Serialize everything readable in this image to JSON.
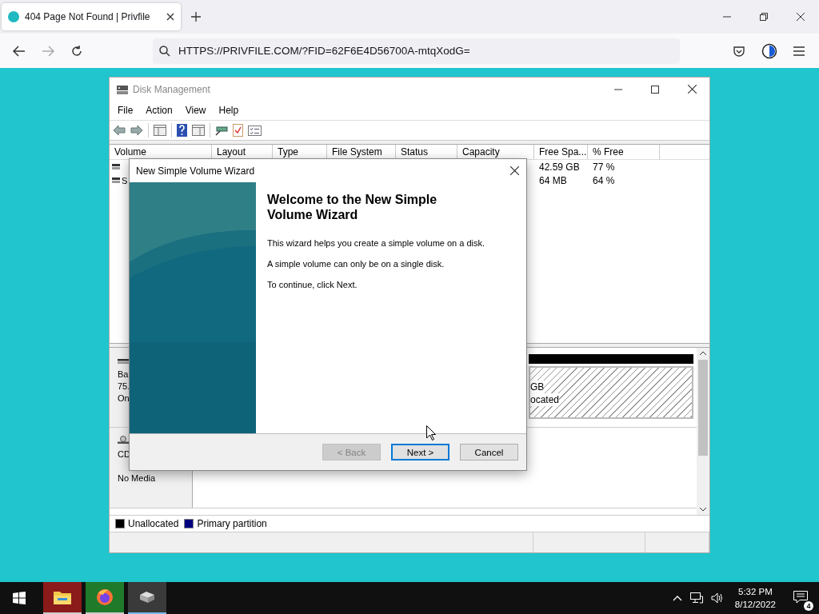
{
  "browser": {
    "tabs": [
      {
        "title": "404 Page Not Found | Privfile",
        "selected": true
      }
    ],
    "url": "HTTPS://PRIVFILE.COM/?FID=62F6E4D56700A-mtqXodG="
  },
  "window": {
    "title": "Disk Management",
    "menu": [
      "File",
      "Action",
      "View",
      "Help"
    ],
    "table": {
      "columns": [
        "Volume",
        "Layout",
        "Type",
        "File System",
        "Status",
        "Capacity",
        "Free Spa...",
        "% Free"
      ],
      "rows": [
        {
          "free_space": "42.59 GB",
          "percent_free": "77 %"
        },
        {
          "volume": "S",
          "free_space": "64 MB",
          "percent_free": "64 %"
        }
      ]
    },
    "disks": [
      {
        "kind": "disk",
        "lines": [
          "Ba",
          "75.",
          "On"
        ],
        "partition": {
          "lines": [
            "GB",
            "ocated"
          ]
        }
      },
      {
        "kind": "cdrom",
        "lines": [
          "CD",
          "No Media"
        ]
      }
    ],
    "legend": [
      {
        "label": "Unallocated",
        "color": "#000000"
      },
      {
        "label": "Primary partition",
        "color": "#000080"
      }
    ]
  },
  "dialog": {
    "title": "New Simple Volume Wizard",
    "heading": "Welcome to the New Simple Volume Wizard",
    "paragraphs": [
      "This wizard helps you create a simple volume on a disk.",
      "A simple volume can only be on a single disk.",
      "To continue, click Next."
    ],
    "buttons": [
      {
        "label": "< Back",
        "disabled": true,
        "default": false
      },
      {
        "label": "Next >",
        "disabled": false,
        "default": true
      },
      {
        "label": "Cancel",
        "disabled": false,
        "default": false
      }
    ]
  },
  "taskbar": {
    "apps": [
      {
        "kind": "folder",
        "color": "#8b1a1a",
        "active": false
      },
      {
        "kind": "browser",
        "color": "#1f7a2a",
        "active": false
      },
      {
        "kind": "disk",
        "color": "#3a3a3a",
        "active": true
      }
    ],
    "time": "5:32 PM",
    "date": "8/12/2022",
    "notifications": "4"
  }
}
